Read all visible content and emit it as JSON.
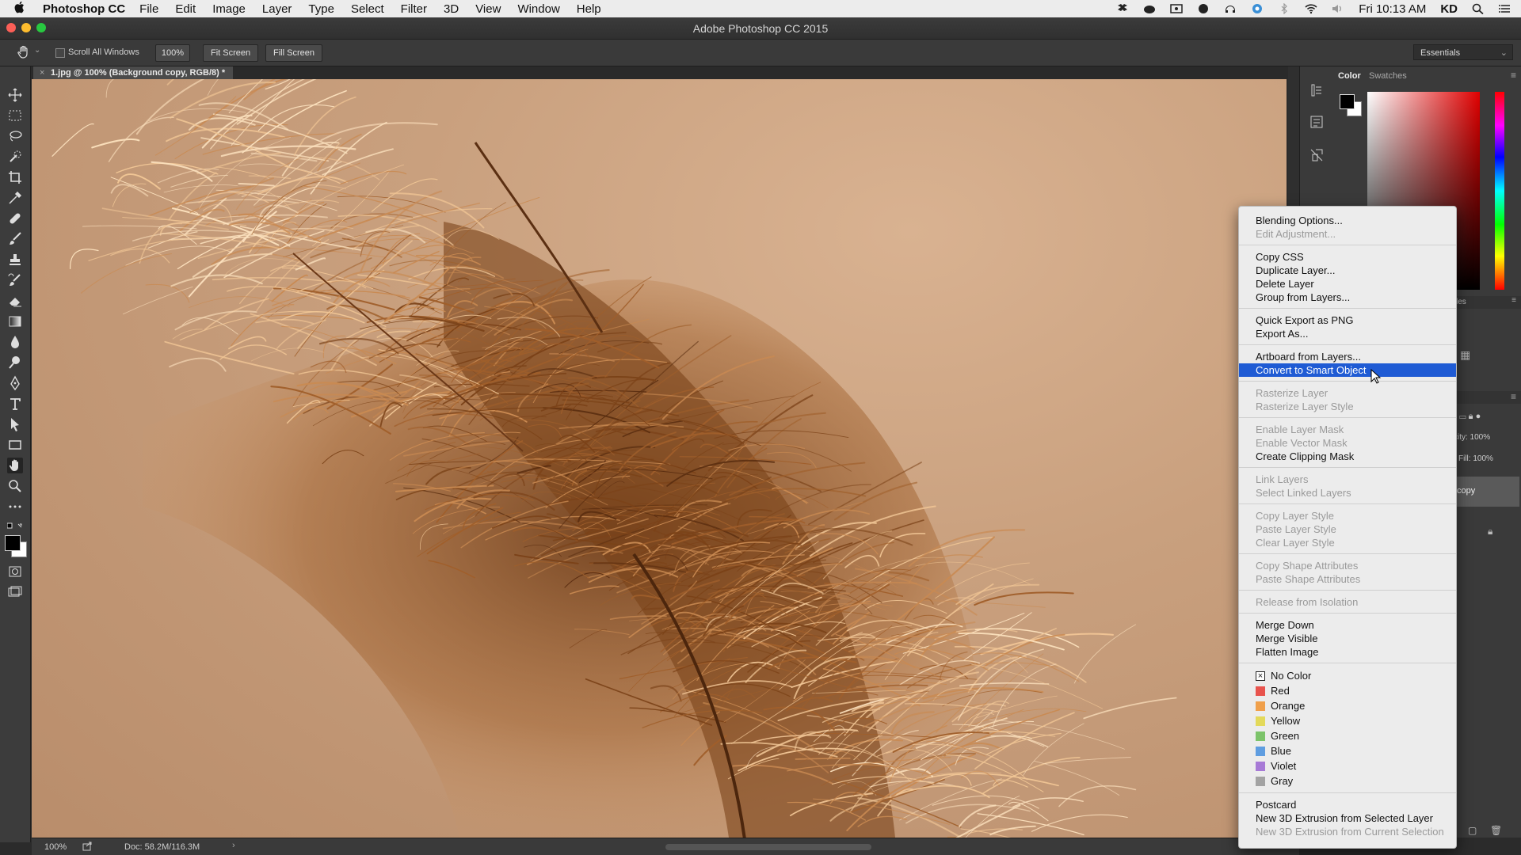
{
  "menubar": {
    "app_name": "Photoshop CC",
    "menus": [
      "File",
      "Edit",
      "Image",
      "Layer",
      "Type",
      "Select",
      "Filter",
      "3D",
      "View",
      "Window",
      "Help"
    ],
    "clock": "Fri 10:13 AM",
    "user": "KD"
  },
  "window": {
    "title": "Adobe Photoshop CC 2015"
  },
  "options_bar": {
    "scroll_all_windows": "Scroll All Windows",
    "zoom_button": "100%",
    "fit_screen": "Fit Screen",
    "fill_screen": "Fill Screen",
    "workspace": "Essentials"
  },
  "document": {
    "tab_title": "1.jpg @ 100% (Background copy, RGB/8) *",
    "close_glyph": "×"
  },
  "status_bar": {
    "zoom": "100%",
    "doc_info": "Doc: 58.2M/116.3M",
    "arrow": "›"
  },
  "panels": {
    "color_tab": "Color",
    "swatches_tab": "Swatches",
    "styles_label": "les",
    "opacity_label": "city: 100%",
    "fill_label": "Fill: 100%",
    "layer_name_partial": "copy"
  },
  "context_menu": {
    "groups": [
      [
        {
          "label": "Blending Options...",
          "enabled": true
        },
        {
          "label": "Edit Adjustment...",
          "enabled": false
        }
      ],
      [
        {
          "label": "Copy CSS",
          "enabled": true
        },
        {
          "label": "Duplicate Layer...",
          "enabled": true
        },
        {
          "label": "Delete Layer",
          "enabled": true
        },
        {
          "label": "Group from Layers...",
          "enabled": true
        }
      ],
      [
        {
          "label": "Quick Export as PNG",
          "enabled": true
        },
        {
          "label": "Export As...",
          "enabled": true
        }
      ],
      [
        {
          "label": "Artboard from Layers...",
          "enabled": true
        },
        {
          "label": "Convert to Smart Object",
          "enabled": true,
          "highlighted": true
        }
      ],
      [
        {
          "label": "Rasterize Layer",
          "enabled": false
        },
        {
          "label": "Rasterize Layer Style",
          "enabled": false
        }
      ],
      [
        {
          "label": "Enable Layer Mask",
          "enabled": false
        },
        {
          "label": "Enable Vector Mask",
          "enabled": false
        },
        {
          "label": "Create Clipping Mask",
          "enabled": true
        }
      ],
      [
        {
          "label": "Link Layers",
          "enabled": false
        },
        {
          "label": "Select Linked Layers",
          "enabled": false
        }
      ],
      [
        {
          "label": "Copy Layer Style",
          "enabled": false
        },
        {
          "label": "Paste Layer Style",
          "enabled": false
        },
        {
          "label": "Clear Layer Style",
          "enabled": false
        }
      ],
      [
        {
          "label": "Copy Shape Attributes",
          "enabled": false
        },
        {
          "label": "Paste Shape Attributes",
          "enabled": false
        }
      ],
      [
        {
          "label": "Release from Isolation",
          "enabled": false
        }
      ],
      [
        {
          "label": "Merge Down",
          "enabled": true
        },
        {
          "label": "Merge Visible",
          "enabled": true
        },
        {
          "label": "Flatten Image",
          "enabled": true
        }
      ]
    ],
    "color_labels": [
      {
        "label": "No Color",
        "color": "none"
      },
      {
        "label": "Red",
        "color": "#e8534d"
      },
      {
        "label": "Orange",
        "color": "#f0a04b"
      },
      {
        "label": "Yellow",
        "color": "#e3d95a"
      },
      {
        "label": "Green",
        "color": "#7cc36a"
      },
      {
        "label": "Blue",
        "color": "#5f9de0"
      },
      {
        "label": "Violet",
        "color": "#a77ad6"
      },
      {
        "label": "Gray",
        "color": "#a3a3a3"
      }
    ],
    "tail": [
      {
        "label": "Postcard",
        "enabled": true
      },
      {
        "label": "New 3D Extrusion from Selected Layer",
        "enabled": true
      },
      {
        "label": "New 3D Extrusion from Current Selection",
        "enabled": false
      }
    ]
  },
  "colors": {
    "highlight": "#1f5bd4",
    "menu_bg": "#ececec",
    "canvas_bg": "#c9a07e",
    "grass": "#8a5227"
  }
}
